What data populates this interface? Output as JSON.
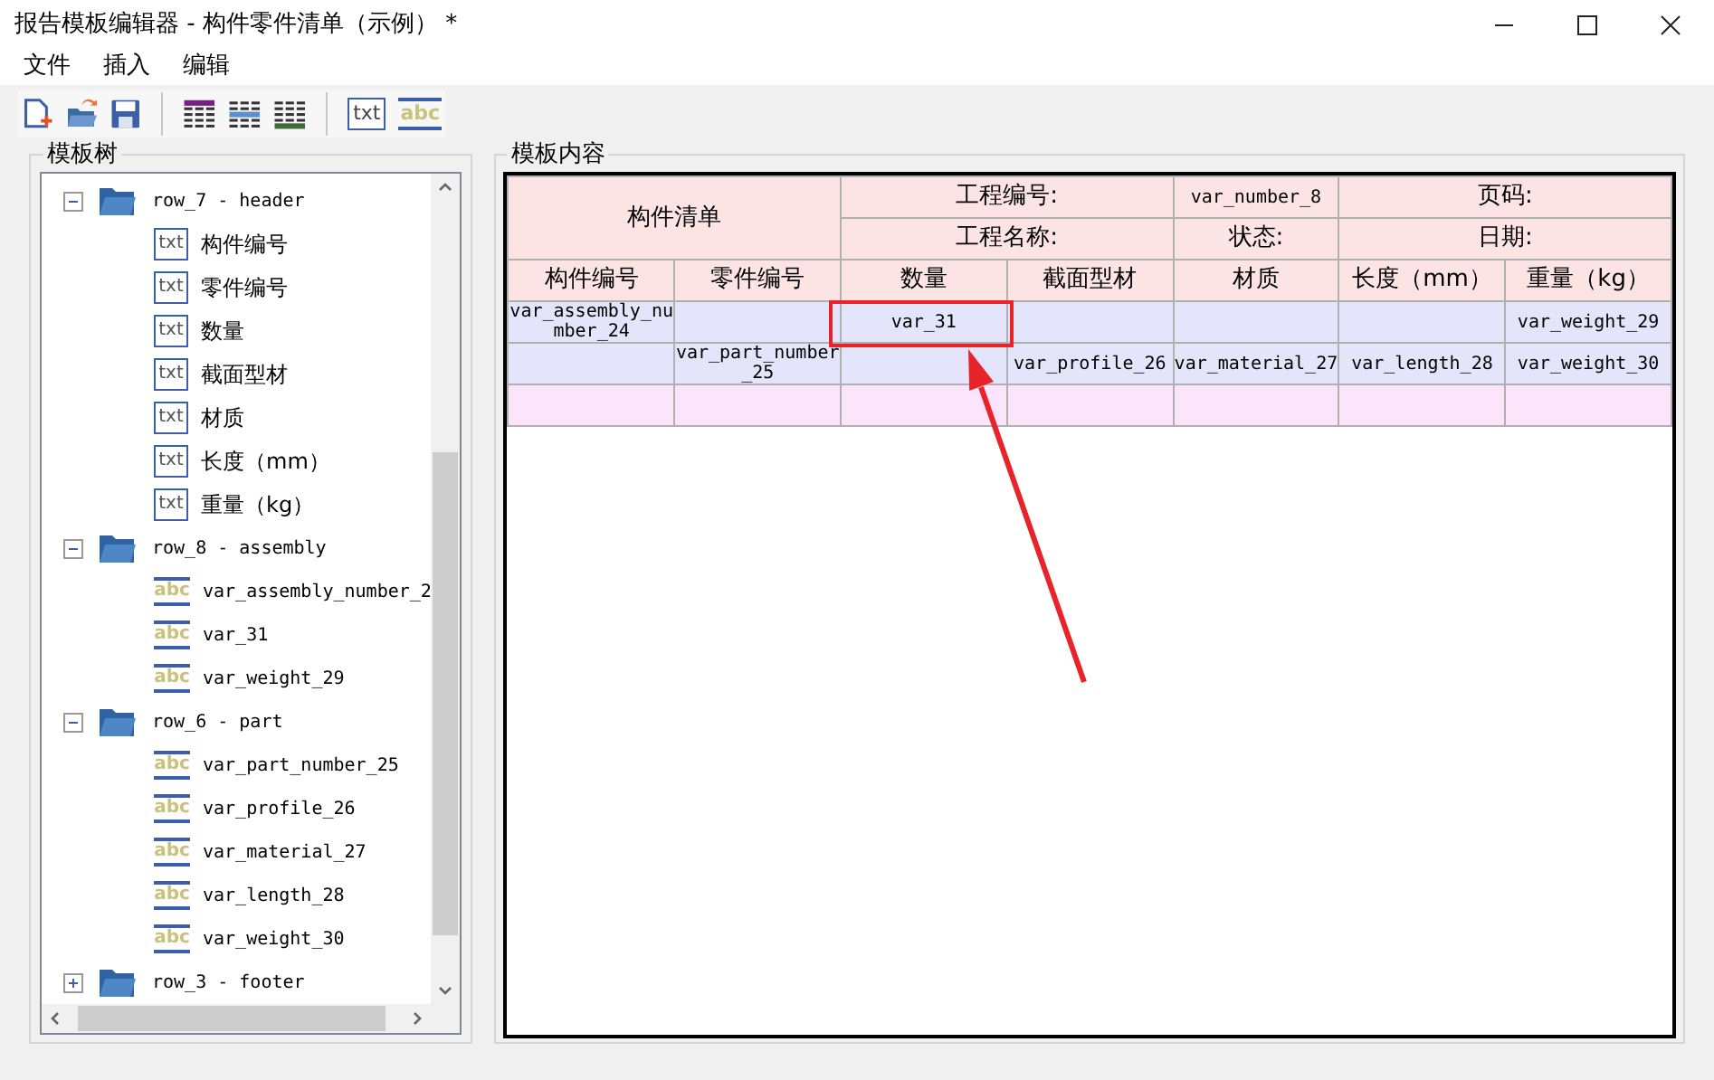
{
  "window": {
    "title": "报告模板编辑器 - 构件零件清单（示例） *"
  },
  "menu": [
    {
      "label": "文件"
    },
    {
      "label": "插入"
    },
    {
      "label": "编辑"
    }
  ],
  "toolbar": [
    {
      "kind": "new"
    },
    {
      "kind": "open"
    },
    {
      "kind": "save"
    },
    {
      "kind": "sep"
    },
    {
      "kind": "table-header"
    },
    {
      "kind": "table-row"
    },
    {
      "kind": "table-footer"
    },
    {
      "kind": "sep"
    },
    {
      "kind": "txt",
      "label": "txt"
    },
    {
      "kind": "abc",
      "label": "abc"
    }
  ],
  "tree_panel": {
    "title": "模板树",
    "nodes": [
      {
        "kind": "folder",
        "label": "row_7 - header",
        "expanded": true,
        "children": [
          {
            "kind": "txt",
            "icon_text": "txt",
            "label": "构件编号"
          },
          {
            "kind": "txt",
            "icon_text": "txt",
            "label": "零件编号"
          },
          {
            "kind": "txt",
            "icon_text": "txt",
            "label": "数量"
          },
          {
            "kind": "txt",
            "icon_text": "txt",
            "label": "截面型材"
          },
          {
            "kind": "txt",
            "icon_text": "txt",
            "label": "材质"
          },
          {
            "kind": "txt",
            "icon_text": "txt",
            "label": "长度（mm）"
          },
          {
            "kind": "txt",
            "icon_text": "txt",
            "label": "重量（kg）"
          }
        ]
      },
      {
        "kind": "folder",
        "label": "row_8 - assembly",
        "expanded": true,
        "children": [
          {
            "kind": "abc",
            "icon_text": "abc",
            "label": "var_assembly_number_2"
          },
          {
            "kind": "abc",
            "icon_text": "abc",
            "label": "var_31"
          },
          {
            "kind": "abc",
            "icon_text": "abc",
            "label": "var_weight_29"
          }
        ]
      },
      {
        "kind": "folder",
        "label": "row_6 - part",
        "expanded": true,
        "children": [
          {
            "kind": "abc",
            "icon_text": "abc",
            "label": "var_part_number_25"
          },
          {
            "kind": "abc",
            "icon_text": "abc",
            "label": "var_profile_26"
          },
          {
            "kind": "abc",
            "icon_text": "abc",
            "label": "var_material_27"
          },
          {
            "kind": "abc",
            "icon_text": "abc",
            "label": "var_length_28"
          },
          {
            "kind": "abc",
            "icon_text": "abc",
            "label": "var_weight_30"
          }
        ]
      },
      {
        "kind": "folder",
        "label": "row_3 - footer",
        "expanded": false
      }
    ]
  },
  "content_panel": {
    "title": "模板内容",
    "title_block": {
      "name": "构件清单",
      "project_no_label": "工程编号:",
      "project_no": "var_number_8",
      "page_label": "页码:",
      "project_name_label": "工程名称:",
      "status_label": "状态:",
      "date_label": "日期:"
    },
    "columns": [
      "构件编号",
      "零件编号",
      "数量",
      "截面型材",
      "材质",
      "长度（mm）",
      "重量（kg）"
    ],
    "rows": [
      {
        "kind": "assembly",
        "cells": [
          {
            "text": "var_assembly_number_24",
            "marked": false
          },
          {
            "marked": false
          },
          {
            "text": "var_31",
            "marked": true
          },
          {
            "marked": false
          },
          {
            "marked": false
          },
          {
            "marked": false
          },
          {
            "text": "var_weight_29",
            "marked": false
          }
        ]
      },
      {
        "kind": "part",
        "cells": [
          {
            "marked": false
          },
          {
            "text": "var_part_number_25",
            "marked": false
          },
          {
            "marked": false
          },
          {
            "text": "var_profile_26",
            "marked": false
          },
          {
            "text": "var_material_27",
            "marked": false
          },
          {
            "text": "var_length_28",
            "marked": false
          },
          {
            "text": "var_weight_30",
            "marked": false
          }
        ]
      },
      {
        "kind": "blank",
        "cells": [
          {
            "marked": false
          },
          {
            "marked": false
          },
          {
            "marked": false
          },
          {
            "marked": false
          },
          {
            "marked": false
          },
          {
            "marked": false
          },
          {
            "marked": false
          }
        ]
      }
    ]
  }
}
